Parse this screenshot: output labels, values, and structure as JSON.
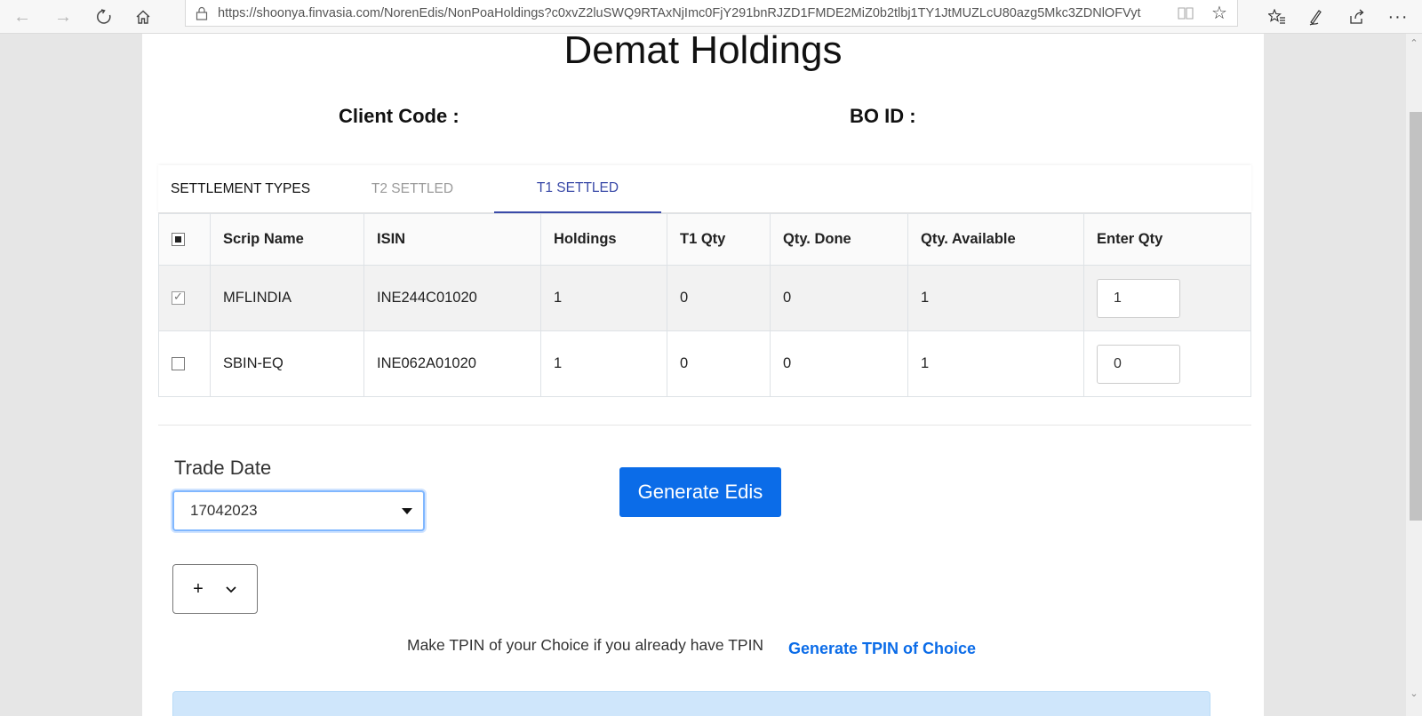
{
  "browser": {
    "url": "https://shoonya.finvasia.com/NorenEdis/NonPoaHoldings?c0xvZ2luSWQ9RTAxNjImc0FjY291bnRJZD1FMDE2MiZ0b2tlbj1TY1JtMUZLcU80azg5Mkc3ZDNlOFVyt",
    "icons": [
      "back-icon",
      "forward-icon",
      "refresh-icon",
      "home-icon",
      "lock-icon",
      "reading-view-icon",
      "favorite-star-icon",
      "favorites-list-icon",
      "pen-icon",
      "share-icon",
      "more-icon"
    ]
  },
  "page": {
    "title": "Demat Holdings",
    "client_code_label": "Client Code :",
    "bo_id_label": "BO ID :"
  },
  "tabs": {
    "label": "SETTLEMENT TYPES",
    "t2": "T2 SETTLED",
    "t1": "T1 SETTLED",
    "active": "T1 SETTLED",
    "active_color": "#3a4aa8"
  },
  "table": {
    "headers": [
      "Scrip Name",
      "ISIN",
      "Holdings",
      "T1 Qty",
      "Qty. Done",
      "Qty. Available",
      "Enter Qty"
    ],
    "rows": [
      {
        "checked": true,
        "scrip": "MFLINDIA",
        "isin": "INE244C01020",
        "holdings": "1",
        "t1qty": "0",
        "done": "0",
        "available": "1",
        "enter_qty": "1"
      },
      {
        "checked": false,
        "scrip": "SBIN-EQ",
        "isin": "INE062A01020",
        "holdings": "1",
        "t1qty": "0",
        "done": "0",
        "available": "1",
        "enter_qty": "0"
      }
    ]
  },
  "trade": {
    "label": "Trade Date",
    "selected": "17042023"
  },
  "actions": {
    "generate_edis": "Generate Edis",
    "plus": "+",
    "accent": "#0b6ce8"
  },
  "tpin": {
    "text": "Make TPIN of your Choice if you already have TPIN",
    "link": "Generate TPIN of Choice"
  }
}
